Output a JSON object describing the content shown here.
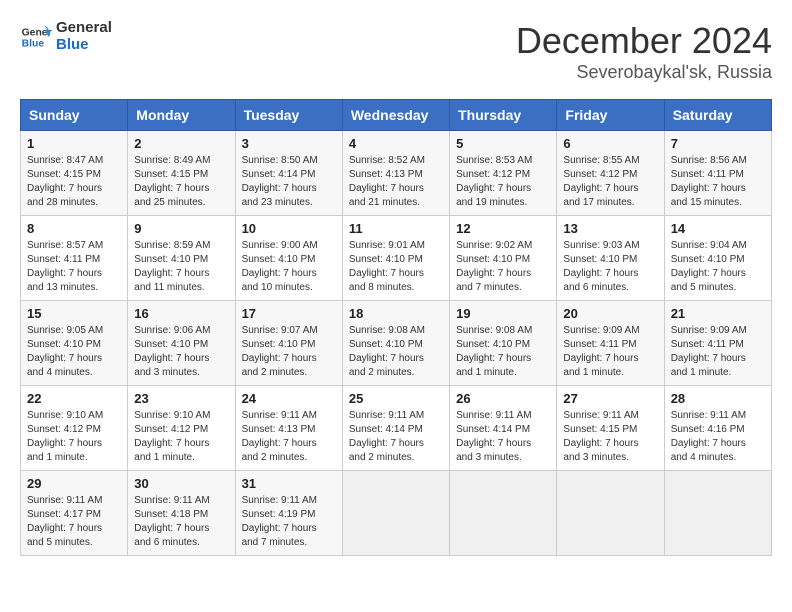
{
  "logo": {
    "text_general": "General",
    "text_blue": "Blue"
  },
  "title": "December 2024",
  "subtitle": "Severobaykal'sk, Russia",
  "weekdays": [
    "Sunday",
    "Monday",
    "Tuesday",
    "Wednesday",
    "Thursday",
    "Friday",
    "Saturday"
  ],
  "weeks": [
    [
      {
        "day": "1",
        "sunrise": "Sunrise: 8:47 AM",
        "sunset": "Sunset: 4:15 PM",
        "daylight": "Daylight: 7 hours and 28 minutes."
      },
      {
        "day": "2",
        "sunrise": "Sunrise: 8:49 AM",
        "sunset": "Sunset: 4:15 PM",
        "daylight": "Daylight: 7 hours and 25 minutes."
      },
      {
        "day": "3",
        "sunrise": "Sunrise: 8:50 AM",
        "sunset": "Sunset: 4:14 PM",
        "daylight": "Daylight: 7 hours and 23 minutes."
      },
      {
        "day": "4",
        "sunrise": "Sunrise: 8:52 AM",
        "sunset": "Sunset: 4:13 PM",
        "daylight": "Daylight: 7 hours and 21 minutes."
      },
      {
        "day": "5",
        "sunrise": "Sunrise: 8:53 AM",
        "sunset": "Sunset: 4:12 PM",
        "daylight": "Daylight: 7 hours and 19 minutes."
      },
      {
        "day": "6",
        "sunrise": "Sunrise: 8:55 AM",
        "sunset": "Sunset: 4:12 PM",
        "daylight": "Daylight: 7 hours and 17 minutes."
      },
      {
        "day": "7",
        "sunrise": "Sunrise: 8:56 AM",
        "sunset": "Sunset: 4:11 PM",
        "daylight": "Daylight: 7 hours and 15 minutes."
      }
    ],
    [
      {
        "day": "8",
        "sunrise": "Sunrise: 8:57 AM",
        "sunset": "Sunset: 4:11 PM",
        "daylight": "Daylight: 7 hours and 13 minutes."
      },
      {
        "day": "9",
        "sunrise": "Sunrise: 8:59 AM",
        "sunset": "Sunset: 4:10 PM",
        "daylight": "Daylight: 7 hours and 11 minutes."
      },
      {
        "day": "10",
        "sunrise": "Sunrise: 9:00 AM",
        "sunset": "Sunset: 4:10 PM",
        "daylight": "Daylight: 7 hours and 10 minutes."
      },
      {
        "day": "11",
        "sunrise": "Sunrise: 9:01 AM",
        "sunset": "Sunset: 4:10 PM",
        "daylight": "Daylight: 7 hours and 8 minutes."
      },
      {
        "day": "12",
        "sunrise": "Sunrise: 9:02 AM",
        "sunset": "Sunset: 4:10 PM",
        "daylight": "Daylight: 7 hours and 7 minutes."
      },
      {
        "day": "13",
        "sunrise": "Sunrise: 9:03 AM",
        "sunset": "Sunset: 4:10 PM",
        "daylight": "Daylight: 7 hours and 6 minutes."
      },
      {
        "day": "14",
        "sunrise": "Sunrise: 9:04 AM",
        "sunset": "Sunset: 4:10 PM",
        "daylight": "Daylight: 7 hours and 5 minutes."
      }
    ],
    [
      {
        "day": "15",
        "sunrise": "Sunrise: 9:05 AM",
        "sunset": "Sunset: 4:10 PM",
        "daylight": "Daylight: 7 hours and 4 minutes."
      },
      {
        "day": "16",
        "sunrise": "Sunrise: 9:06 AM",
        "sunset": "Sunset: 4:10 PM",
        "daylight": "Daylight: 7 hours and 3 minutes."
      },
      {
        "day": "17",
        "sunrise": "Sunrise: 9:07 AM",
        "sunset": "Sunset: 4:10 PM",
        "daylight": "Daylight: 7 hours and 2 minutes."
      },
      {
        "day": "18",
        "sunrise": "Sunrise: 9:08 AM",
        "sunset": "Sunset: 4:10 PM",
        "daylight": "Daylight: 7 hours and 2 minutes."
      },
      {
        "day": "19",
        "sunrise": "Sunrise: 9:08 AM",
        "sunset": "Sunset: 4:10 PM",
        "daylight": "Daylight: 7 hours and 1 minute."
      },
      {
        "day": "20",
        "sunrise": "Sunrise: 9:09 AM",
        "sunset": "Sunset: 4:11 PM",
        "daylight": "Daylight: 7 hours and 1 minute."
      },
      {
        "day": "21",
        "sunrise": "Sunrise: 9:09 AM",
        "sunset": "Sunset: 4:11 PM",
        "daylight": "Daylight: 7 hours and 1 minute."
      }
    ],
    [
      {
        "day": "22",
        "sunrise": "Sunrise: 9:10 AM",
        "sunset": "Sunset: 4:12 PM",
        "daylight": "Daylight: 7 hours and 1 minute."
      },
      {
        "day": "23",
        "sunrise": "Sunrise: 9:10 AM",
        "sunset": "Sunset: 4:12 PM",
        "daylight": "Daylight: 7 hours and 1 minute."
      },
      {
        "day": "24",
        "sunrise": "Sunrise: 9:11 AM",
        "sunset": "Sunset: 4:13 PM",
        "daylight": "Daylight: 7 hours and 2 minutes."
      },
      {
        "day": "25",
        "sunrise": "Sunrise: 9:11 AM",
        "sunset": "Sunset: 4:14 PM",
        "daylight": "Daylight: 7 hours and 2 minutes."
      },
      {
        "day": "26",
        "sunrise": "Sunrise: 9:11 AM",
        "sunset": "Sunset: 4:14 PM",
        "daylight": "Daylight: 7 hours and 3 minutes."
      },
      {
        "day": "27",
        "sunrise": "Sunrise: 9:11 AM",
        "sunset": "Sunset: 4:15 PM",
        "daylight": "Daylight: 7 hours and 3 minutes."
      },
      {
        "day": "28",
        "sunrise": "Sunrise: 9:11 AM",
        "sunset": "Sunset: 4:16 PM",
        "daylight": "Daylight: 7 hours and 4 minutes."
      }
    ],
    [
      {
        "day": "29",
        "sunrise": "Sunrise: 9:11 AM",
        "sunset": "Sunset: 4:17 PM",
        "daylight": "Daylight: 7 hours and 5 minutes."
      },
      {
        "day": "30",
        "sunrise": "Sunrise: 9:11 AM",
        "sunset": "Sunset: 4:18 PM",
        "daylight": "Daylight: 7 hours and 6 minutes."
      },
      {
        "day": "31",
        "sunrise": "Sunrise: 9:11 AM",
        "sunset": "Sunset: 4:19 PM",
        "daylight": "Daylight: 7 hours and 7 minutes."
      },
      null,
      null,
      null,
      null
    ]
  ]
}
